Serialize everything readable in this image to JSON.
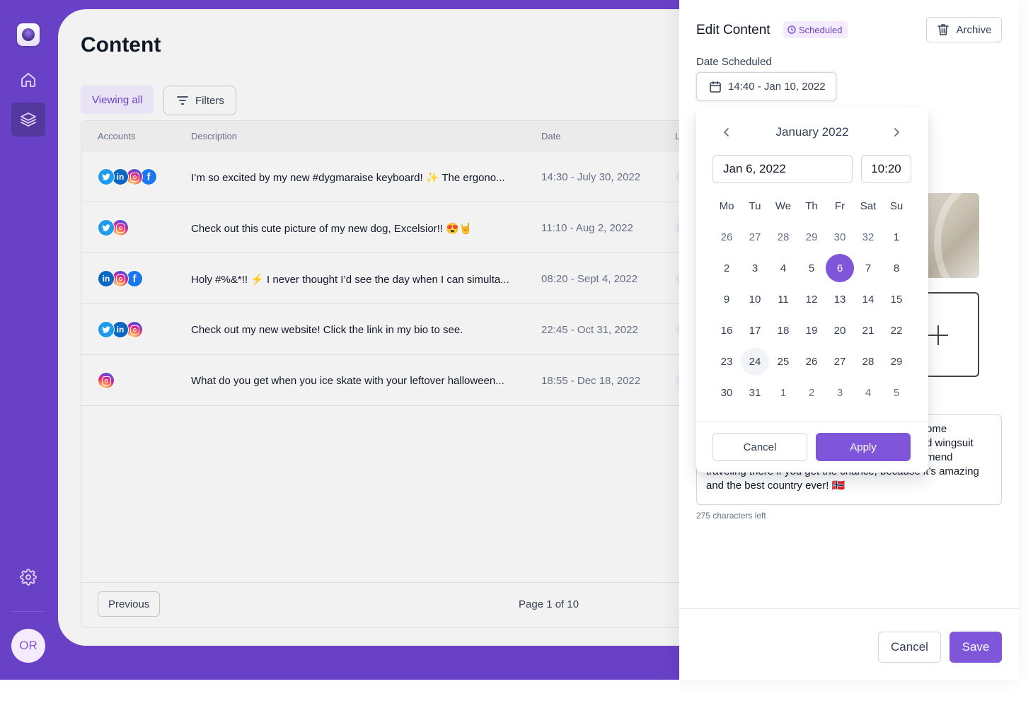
{
  "sidebar": {
    "items": [
      {
        "icon": "home-icon",
        "active": false
      },
      {
        "icon": "layers-icon",
        "active": true
      },
      {
        "icon": "gear-icon",
        "active": false
      }
    ],
    "avatar_initials": "OR"
  },
  "main": {
    "title": "Content",
    "view_tab": "Viewing all",
    "filters_label": "Filters",
    "columns": [
      "Accounts",
      "Description",
      "Date",
      "L"
    ],
    "rows": [
      {
        "accounts": [
          "twitter",
          "linkedin",
          "instagram",
          "facebook"
        ],
        "description": "I’m so excited by my new #dygmaraise keyboard! ✨ The ergono...",
        "date": "14:30 - July 30, 2022"
      },
      {
        "accounts": [
          "twitter",
          "instagram"
        ],
        "description": "Check out this cute picture of my new dog, Excelsior!! 😍🤘",
        "date": "11:10 - Aug 2, 2022"
      },
      {
        "accounts": [
          "linkedin",
          "instagram",
          "facebook"
        ],
        "description": "Holy #%&*!! ⚡ I never thought I’d see the day when I can simulta...",
        "date": "08:20 - Sept 4, 2022"
      },
      {
        "accounts": [
          "twitter",
          "linkedin",
          "instagram"
        ],
        "description": "Check out my new website! Click the link in my bio to see.",
        "date": "22:45 - Oct 31, 2022"
      },
      {
        "accounts": [
          "instagram"
        ],
        "description": "What do you get when you ice skate with your leftover halloween...",
        "date": "18:55 - Dec 18, 2022"
      }
    ],
    "pagination": {
      "previous_label": "Previous",
      "page_info": "Page 1 of 10"
    }
  },
  "panel": {
    "title": "Edit Content",
    "status_badge": "Scheduled",
    "archive_label": "Archive",
    "date_label": "Date Scheduled",
    "date_value": "14:40 - Jan 10, 2022",
    "caption_lines": [
      "ome",
      "d wingsuit",
      "mend",
      "traveling there if you get the chance, because it’s amazing",
      "and the best country ever! 🇳🇴"
    ],
    "chars_left": "275 characters left",
    "cancel_label": "Cancel",
    "save_label": "Save"
  },
  "datepicker": {
    "month_label": "January 2022",
    "date_input": "Jan 6, 2022",
    "time_input": "10:20",
    "weekdays": [
      "Mo",
      "Tu",
      "We",
      "Th",
      "Fr",
      "Sat",
      "Su"
    ],
    "weeks": [
      [
        {
          "d": "26",
          "m": true
        },
        {
          "d": "27",
          "m": true
        },
        {
          "d": "28",
          "m": true
        },
        {
          "d": "29",
          "m": true
        },
        {
          "d": "30",
          "m": true
        },
        {
          "d": "32",
          "m": true
        },
        {
          "d": "1"
        }
      ],
      [
        {
          "d": "2"
        },
        {
          "d": "3"
        },
        {
          "d": "4"
        },
        {
          "d": "5"
        },
        {
          "d": "6",
          "sel": true
        },
        {
          "d": "7"
        },
        {
          "d": "8"
        }
      ],
      [
        {
          "d": "9"
        },
        {
          "d": "10"
        },
        {
          "d": "11"
        },
        {
          "d": "12"
        },
        {
          "d": "13"
        },
        {
          "d": "14"
        },
        {
          "d": "15"
        }
      ],
      [
        {
          "d": "16"
        },
        {
          "d": "17"
        },
        {
          "d": "18"
        },
        {
          "d": "19"
        },
        {
          "d": "20"
        },
        {
          "d": "21"
        },
        {
          "d": "22"
        }
      ],
      [
        {
          "d": "23"
        },
        {
          "d": "24",
          "today": true
        },
        {
          "d": "25"
        },
        {
          "d": "26"
        },
        {
          "d": "27"
        },
        {
          "d": "28"
        },
        {
          "d": "29"
        }
      ],
      [
        {
          "d": "30"
        },
        {
          "d": "31"
        },
        {
          "d": "1",
          "m": true
        },
        {
          "d": "2",
          "m": true
        },
        {
          "d": "3",
          "m": true
        },
        {
          "d": "4",
          "m": true
        },
        {
          "d": "5",
          "m": true
        }
      ]
    ],
    "cancel_label": "Cancel",
    "apply_label": "Apply"
  },
  "colors": {
    "accent": "#7f56d9",
    "frame": "#6941c6",
    "rail_active": "#53389e"
  }
}
